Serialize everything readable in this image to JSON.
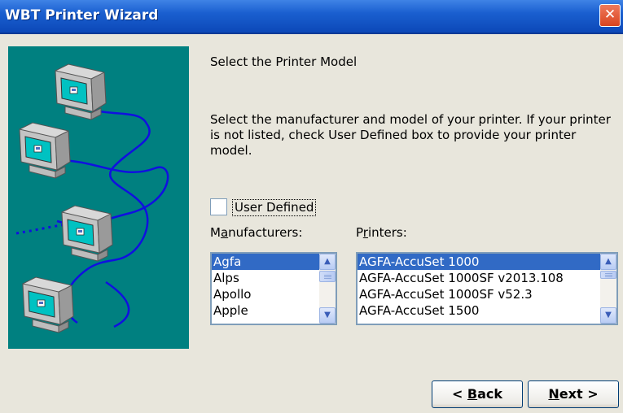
{
  "window": {
    "title": "WBT Printer Wizard",
    "close_glyph": "✕",
    "close_icon": "close-icon"
  },
  "heading": "Select the Printer Model",
  "description": "Select the manufacturer and model of your printer. If your printer is not listed, check User Defined box to provide your printer model.",
  "user_defined": {
    "label": "User Defined",
    "checked": false
  },
  "manufacturers": {
    "label_pre": "M",
    "label_key": "a",
    "label_post": "nufacturers:",
    "items": [
      "Agfa",
      "Alps",
      "Apollo",
      "Apple"
    ],
    "selected": "Agfa"
  },
  "printers": {
    "label_pre": "P",
    "label_key": "r",
    "label_post": "inters:",
    "items": [
      "AGFA-AccuSet 1000",
      "AGFA-AccuSet 1000SF v2013.108",
      "AGFA-AccuSet 1000SF v52.3",
      "AGFA-AccuSet 1500"
    ],
    "selected": "AGFA-AccuSet 1000"
  },
  "buttons": {
    "back": {
      "prefix": "< ",
      "key": "B",
      "rest": "ack"
    },
    "next": {
      "prefix": "",
      "key": "N",
      "rest": "ext >"
    }
  },
  "scroll": {
    "up_glyph": "▲",
    "down_glyph": "▼"
  },
  "colors": {
    "title_bar": "#1a5fd0",
    "panel": "#008080",
    "selection": "#316ac5",
    "dialog_bg": "#e8e6dc"
  }
}
